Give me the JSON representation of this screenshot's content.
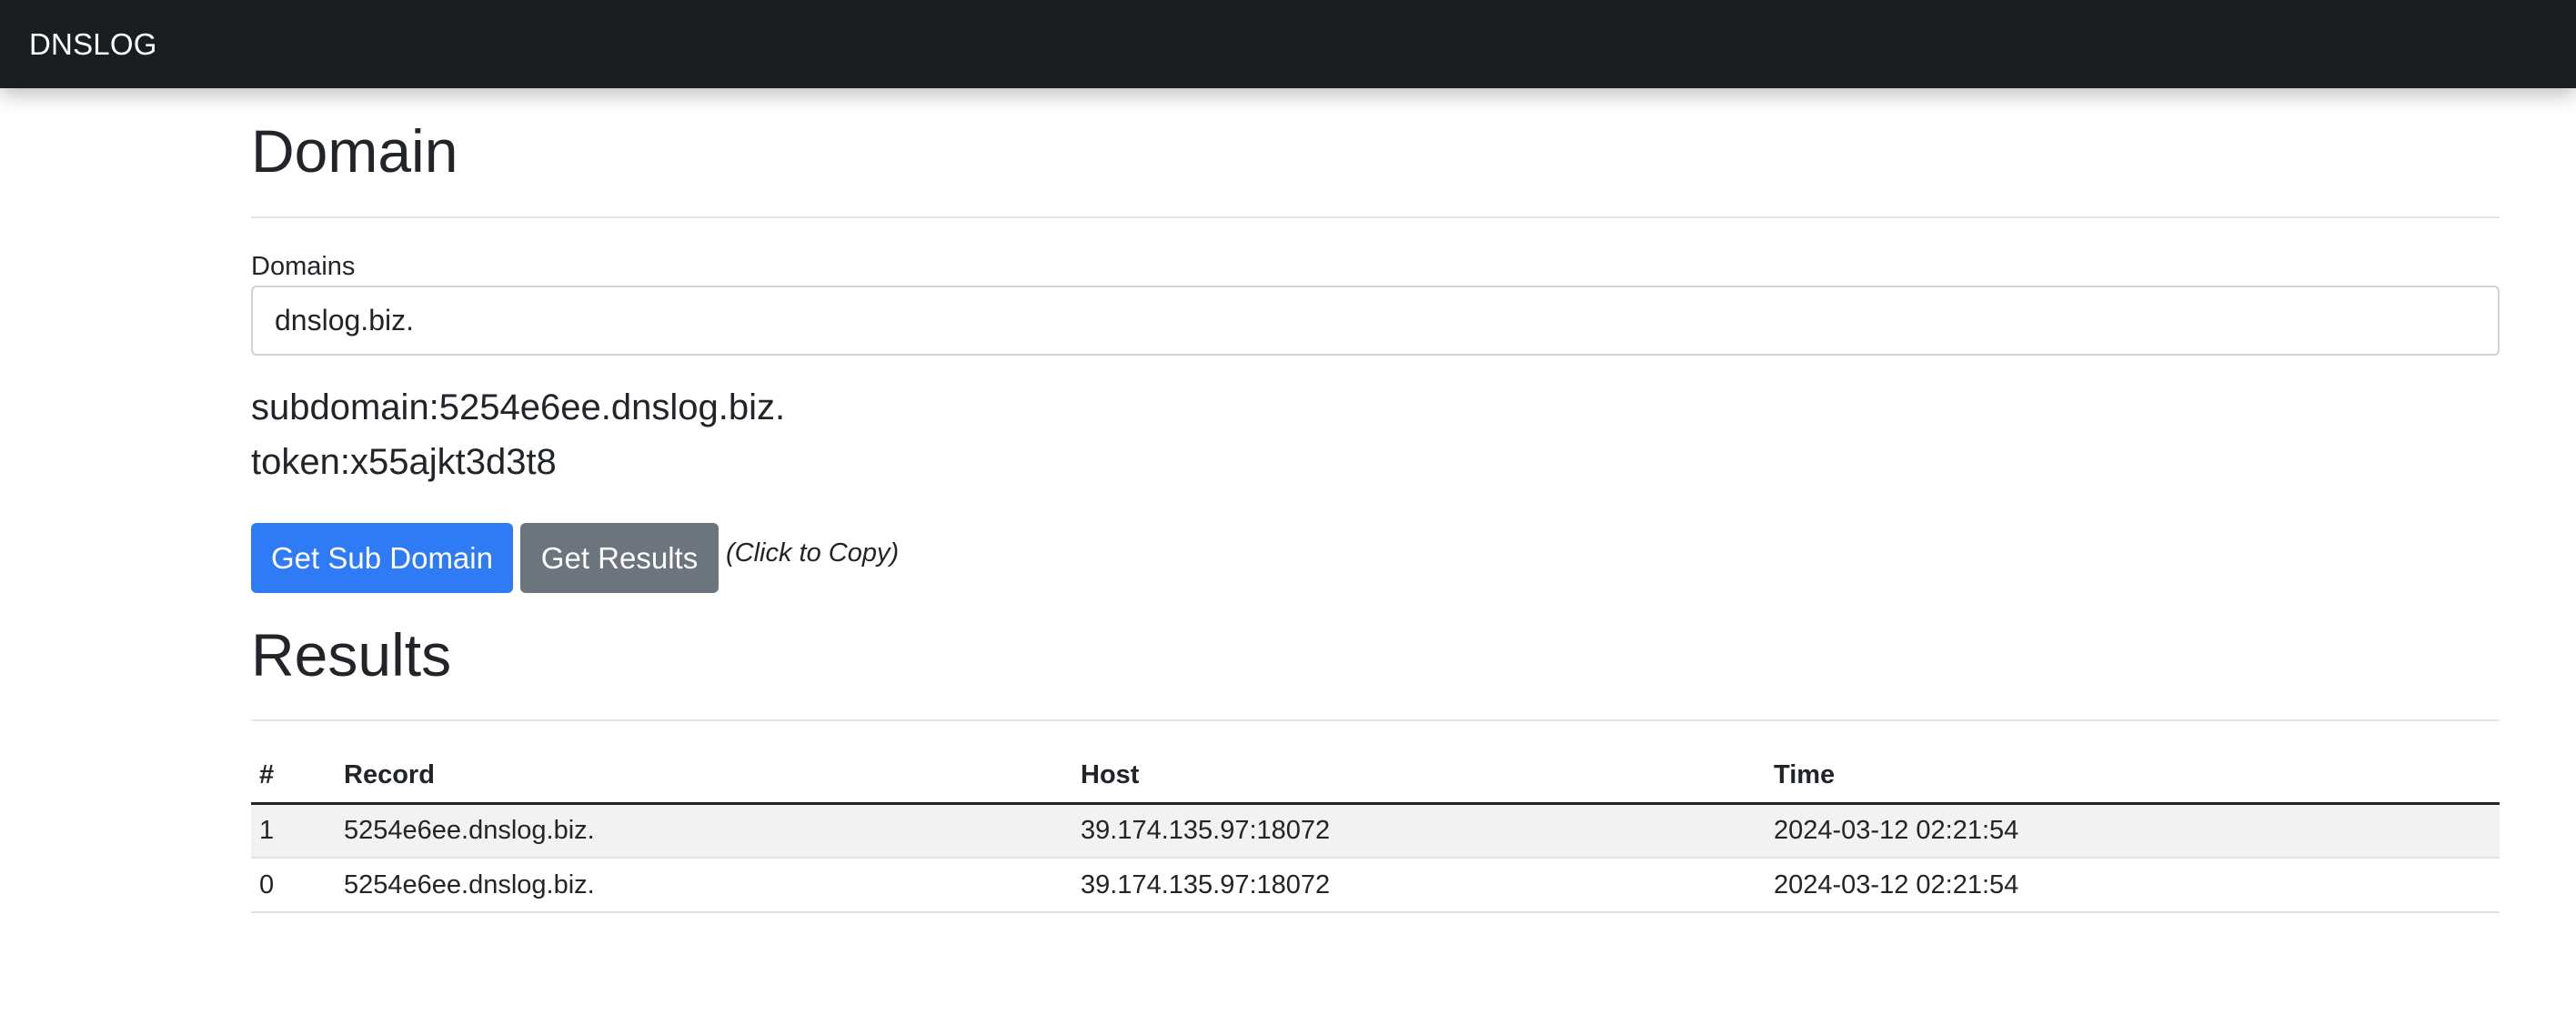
{
  "navbar": {
    "brand": "DNSLOG"
  },
  "domain_section": {
    "title": "Domain",
    "field_label": "Domains",
    "field_value": "dnslog.biz.",
    "subdomain_text": "subdomain:5254e6ee.dnslog.biz.",
    "token_text": "token:x55ajkt3d3t8",
    "buttons": {
      "get_sub_domain": "Get Sub Domain",
      "get_results": "Get Results"
    },
    "copy_hint": "(Click to Copy)"
  },
  "results_section": {
    "title": "Results",
    "columns": [
      "#",
      "Record",
      "Host",
      "Time"
    ],
    "rows": [
      {
        "idx": "1",
        "record": "5254e6ee.dnslog.biz.",
        "host": "39.174.135.97:18072",
        "time": "2024-03-12 02:21:54"
      },
      {
        "idx": "0",
        "record": "5254e6ee.dnslog.biz.",
        "host": "39.174.135.97:18072",
        "time": "2024-03-12 02:21:54"
      }
    ]
  },
  "colors": {
    "navbar_bg": "#1b1e21",
    "primary": "#2f7bf5",
    "secondary": "#6c757d",
    "striped_row": "#f2f2f2"
  }
}
